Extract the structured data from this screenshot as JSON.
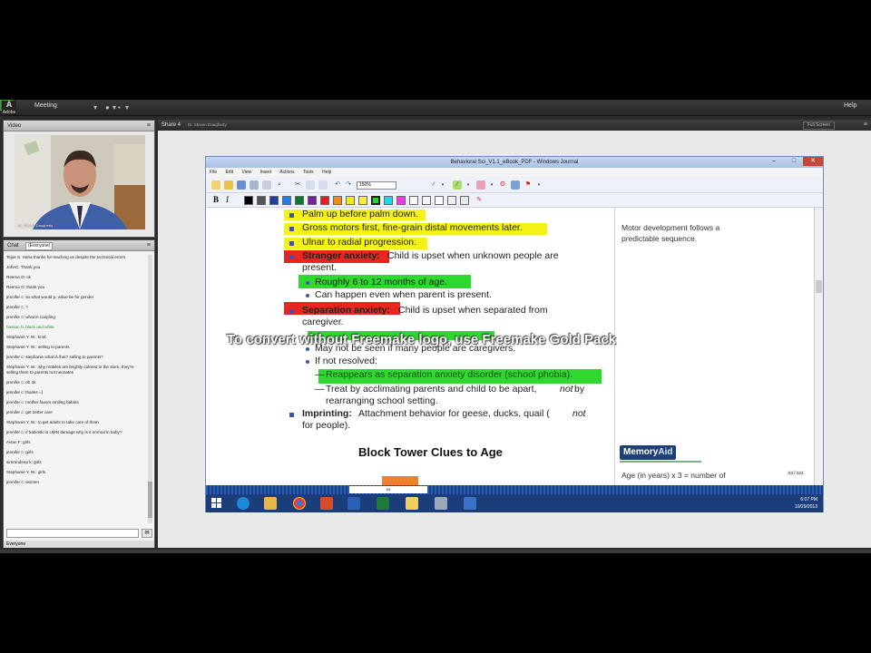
{
  "app": {
    "logo_text": "Adobe",
    "logo_sub": "Conn",
    "menu_meeting": "Meeting",
    "menu_help": "Help"
  },
  "video_pod": {
    "title": "Video",
    "presenter_label": "Dr. Steven Daugherty"
  },
  "chat_pod": {
    "title": "Chat",
    "audience": "(Everyone)",
    "footer": "Everyone",
    "messages": [
      {
        "text": "Tejas S: Haha thanks for teaching us despite the technical errors",
        "green": false
      },
      {
        "text": "JohnC: Thank you",
        "green": false
      },
      {
        "text": "Reema O: ok",
        "green": false
      },
      {
        "text": "Reema O: thank you",
        "green": false
      },
      {
        "text": "jennifer c: so what would p. value be for gender",
        "green": false
      },
      {
        "text": "jennifer c: ?",
        "green": false
      },
      {
        "text": "jennifer c: what is coupling",
        "green": false
      },
      {
        "text": "hassan b: black and white",
        "green": true
      },
      {
        "text": "Stephanie Y. W.: B.W.",
        "green": false
      },
      {
        "text": "Stephanie Y. W.: selling to parents",
        "green": false
      },
      {
        "text": "jennifer c: stephanie what is that? selling to parents?",
        "green": false
      },
      {
        "text": "Stephanie Y. W.: why mobiles are brightly colored in the store, they're selling them to parents not neonates",
        "green": false
      },
      {
        "text": "jennifer c: oh ok",
        "green": false
      },
      {
        "text": "jennifer c: thanks =)",
        "green": false
      },
      {
        "text": "jennifer c: mother favors smiling babies",
        "green": false
      },
      {
        "text": "jennifer c: get better care",
        "green": false
      },
      {
        "text": "Stephanie Y. W.: to get adults to take care of them",
        "green": false
      },
      {
        "text": "jennifer c: if babinski is UMN damage why is it normal in baby?",
        "green": false
      },
      {
        "text": "Aisan F: girls",
        "green": false
      },
      {
        "text": "jennifer c: girls",
        "green": false
      },
      {
        "text": "simrandeep k: girls",
        "green": false
      },
      {
        "text": "Stephanie Y. W.: girls",
        "green": false
      },
      {
        "text": "jennifer c: women",
        "green": false
      }
    ]
  },
  "share_pod": {
    "title": "Share 4",
    "presenter": "Dr. Steven Daugherty",
    "fullscreen_label": "Full Screen"
  },
  "journal": {
    "window_title": "Behavioral Sci_V1.1_eBook_PDF - Windows Journal",
    "menus": [
      "File",
      "Edit",
      "View",
      "Insert",
      "Actions",
      "Tools",
      "Help"
    ],
    "zoom": "150%",
    "page_counter": "63 / 234",
    "taskbar_page": "63"
  },
  "doc": {
    "bullet1": "Palm up before palm down.",
    "bullet2": "Gross motors first, fine-grain distal movements later.",
    "bullet3": "Ulnar to radial progression.",
    "stranger_term": "Stranger anxiety:",
    "stranger_desc": " Child is upset when unknown people are",
    "stranger_desc2": "present.",
    "stranger_sub1": "Roughly 6 to 12 months of age.",
    "stranger_sub2": "Can happen even when parent is present.",
    "separation_term": "Separation anxiety:",
    "separation_desc": " Child is upset when separated from",
    "separation_desc2": "caregiver.",
    "sep_sub1": "May not be seen if many people are caregivers.",
    "sep_sub2": "If not resolved:",
    "sep_sub3": "Reappears as separation anxiety disorder (school phobia).",
    "sep_sub4a": "Treat by acclimating parents and child to be apart, ",
    "sep_sub4b": "not",
    "sep_sub4c": " by",
    "sep_sub4d": "rearranging school setting.",
    "imprinting_term": "Imprinting:",
    "imprinting_desc": " Attachment behavior for geese, ducks, quail (",
    "imprinting_not": "not",
    "imprinting_end": "for people).",
    "section_heading": "Block Tower Clues to Age",
    "sidebar_note": "Motor development follows a predictable sequence.",
    "badge_memory": "Memory",
    "badge_aid": "Aid",
    "age_formula": "Age (in years) x 3 = number of"
  },
  "watermark": "To convert without Freemake logo, use Freemake Gold Pack",
  "tray": {
    "time": "6:07 PM",
    "date": "10/29/2013"
  },
  "colors": {
    "highlight_yellow": "#f5f21a",
    "highlight_green": "#2fd82f",
    "highlight_red": "#e8261f",
    "bullet_blue": "#3b55a8",
    "win_taskbar": "#1b3d7a"
  }
}
